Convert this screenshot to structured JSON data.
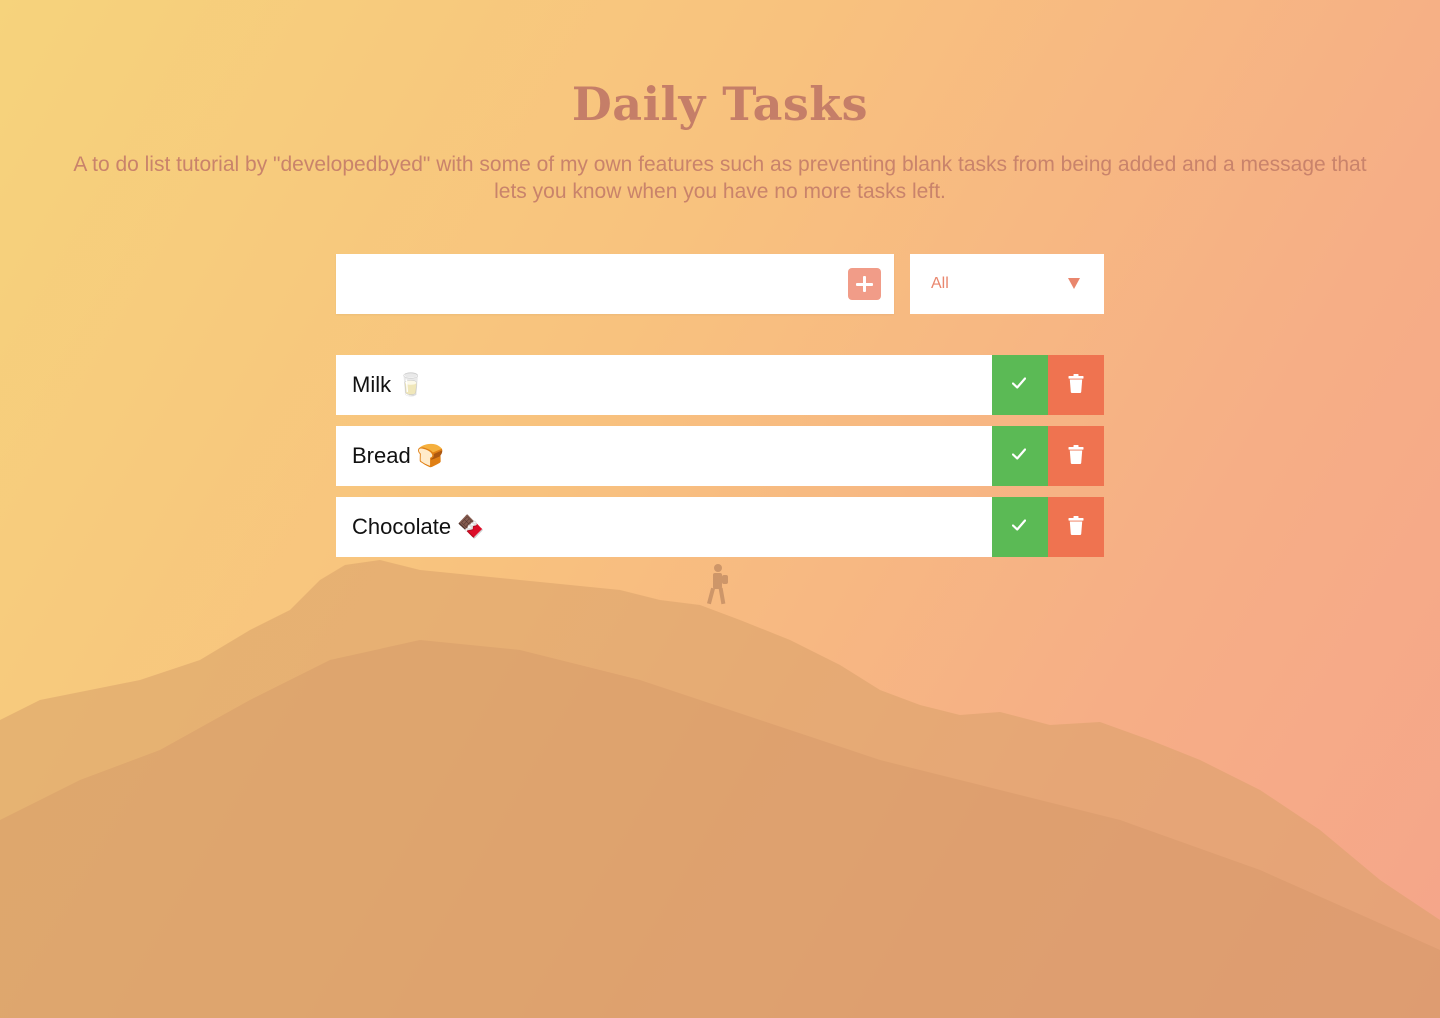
{
  "header": {
    "title": "Daily Tasks",
    "subtitle": "A to do list tutorial by \"developedbyed\" with some of my own features such as preventing blank tasks from being added and a message that lets you know when you have no more tasks left."
  },
  "form": {
    "input_value": "",
    "add_icon": "plus-icon",
    "filter_selected": "All",
    "filter_icon": "chevron-down-icon"
  },
  "todos": [
    {
      "text": "Milk 🥛",
      "complete_icon": "check-icon",
      "delete_icon": "trash-icon"
    },
    {
      "text": "Bread 🍞",
      "complete_icon": "check-icon",
      "delete_icon": "trash-icon"
    },
    {
      "text": "Chocolate 🍫",
      "complete_icon": "check-icon",
      "delete_icon": "trash-icon"
    }
  ],
  "colors": {
    "title": "#c57e68",
    "subtitle": "#c9836b",
    "add_button": "#f19c88",
    "filter_text": "#e9866d",
    "complete": "#5bba55",
    "delete": "#ef7350",
    "gradient_start": "#f6d37c",
    "gradient_end": "#f5a58a"
  }
}
